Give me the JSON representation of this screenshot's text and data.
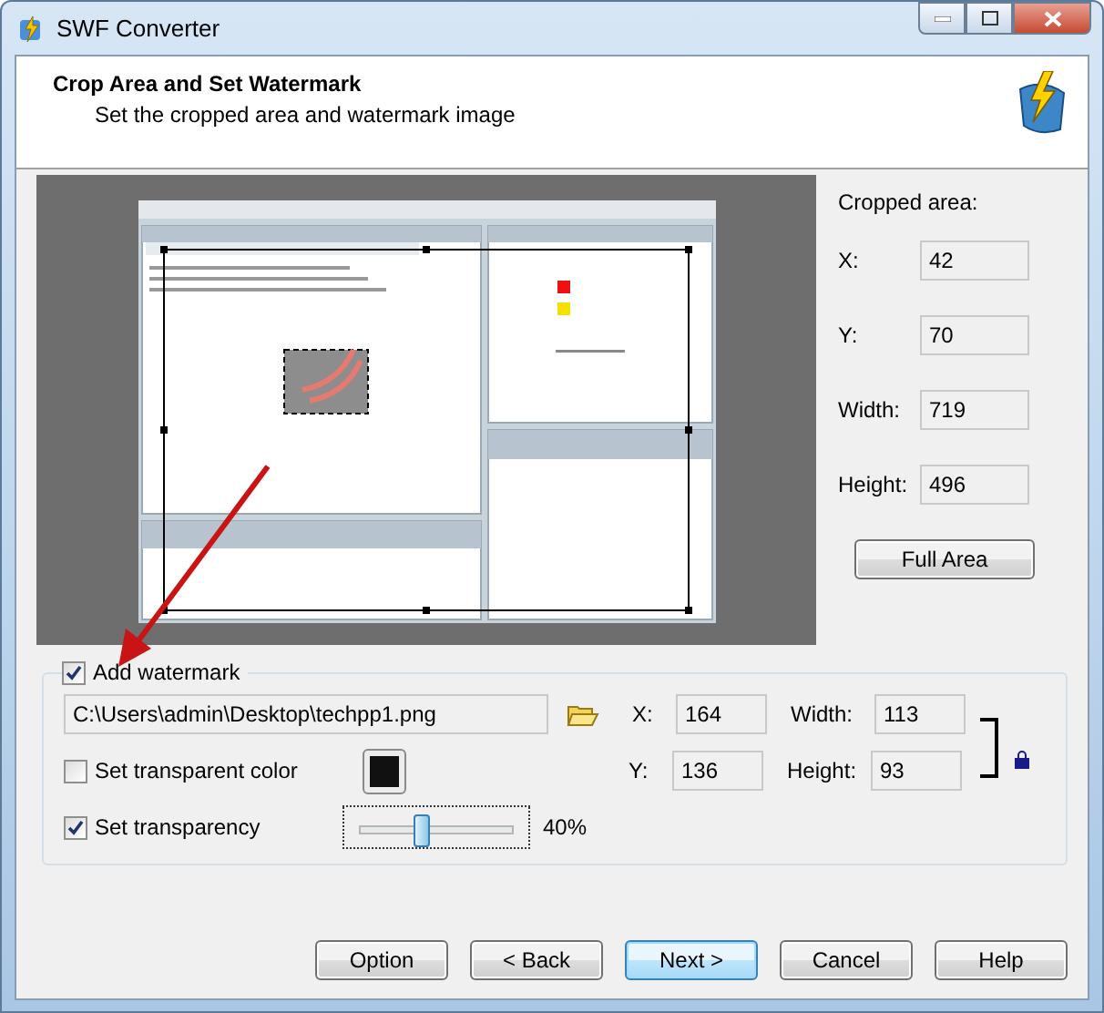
{
  "window": {
    "title": "SWF Converter"
  },
  "header": {
    "title": "Crop Area and Set Watermark",
    "subtitle": "Set the cropped area and watermark image"
  },
  "cropped_area": {
    "label": "Cropped area:",
    "fields": [
      {
        "label": "X:",
        "value": "42"
      },
      {
        "label": "Y:",
        "value": "70"
      },
      {
        "label": "Width:",
        "value": "719"
      },
      {
        "label": "Height:",
        "value": "496"
      }
    ],
    "button": "Full Area"
  },
  "watermark": {
    "label": "Add watermark",
    "checked": true,
    "file_path": "C:\\Users\\admin\\Desktop\\techpp1.png",
    "position": [
      {
        "label": "X:",
        "value": "164"
      },
      {
        "label": "Y:",
        "value": "136"
      }
    ],
    "size": [
      {
        "label": "Width:",
        "value": "113"
      },
      {
        "label": "Height:",
        "value": "93"
      }
    ],
    "transparent_color": {
      "label": "Set transparent color",
      "checked": false
    },
    "transparency": {
      "label": "Set transparency",
      "checked": true,
      "level": 0.4,
      "reading": "40%"
    }
  },
  "buttons": [
    {
      "label": "Option",
      "default": false
    },
    {
      "label": "< Back",
      "default": false
    },
    {
      "label": "Next >",
      "default": true
    },
    {
      "label": "Cancel",
      "default": false
    },
    {
      "label": "Help",
      "default": false
    }
  ]
}
